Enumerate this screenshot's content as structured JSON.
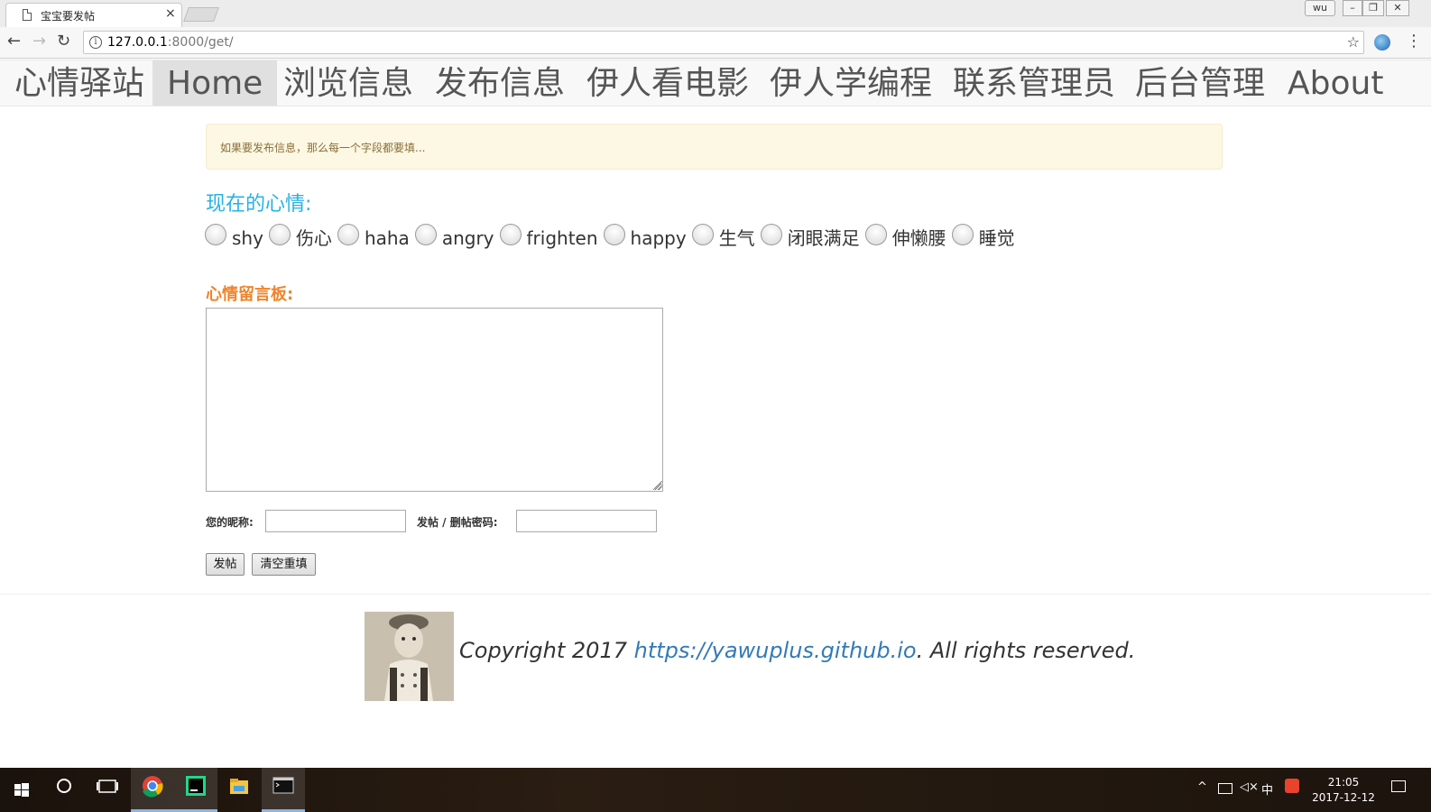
{
  "browser": {
    "tab_title": "宝宝要发帖",
    "tab_close": "×",
    "url_host": "127.0.0.1",
    "url_path": ":8000/get/",
    "user_button": "wu",
    "win_min": "–",
    "win_max": "❐",
    "win_close": "✕",
    "back": "←",
    "forward": "→",
    "reload": "↻",
    "info": "i",
    "bookmark": "☆",
    "menu": "⋮"
  },
  "site_nav": {
    "brand": "心情驿站",
    "items": [
      {
        "label": "Home",
        "active": true
      },
      {
        "label": "浏览信息",
        "active": false
      },
      {
        "label": "发布信息",
        "active": false
      },
      {
        "label": "伊人看电影",
        "active": false
      },
      {
        "label": "伊人学编程",
        "active": false
      },
      {
        "label": "联系管理员",
        "active": false
      },
      {
        "label": "后台管理",
        "active": false
      },
      {
        "label": "About",
        "active": false
      }
    ]
  },
  "alert": {
    "text": "如果要发布信息，那么每一个字段都要填..."
  },
  "mood": {
    "heading": "现在的心情:",
    "options": [
      "shy",
      "伤心",
      "haha",
      "angry",
      "frighten",
      "happy",
      "生气",
      "闭眼满足",
      "伸懒腰",
      "睡觉"
    ]
  },
  "board": {
    "label": "心情留言板:",
    "value": ""
  },
  "form": {
    "nickname_label": "您的昵称:",
    "nickname_value": "",
    "password_label": "发帖 / 删帖密码:",
    "password_value": "",
    "submit_label": "发帖",
    "reset_label": "清空重填"
  },
  "footer": {
    "prefix": "Copyright 2017 ",
    "link": "https://yawuplus.github.io",
    "suffix": ". All rights reserved."
  },
  "taskbar": {
    "ime": "中",
    "time": "21:05",
    "date": "2017-12-12"
  },
  "colors": {
    "mood_heading": "#25b2e6",
    "board_label": "#f0842b",
    "alert_bg": "#fcf8e3",
    "link": "#337ab7"
  }
}
